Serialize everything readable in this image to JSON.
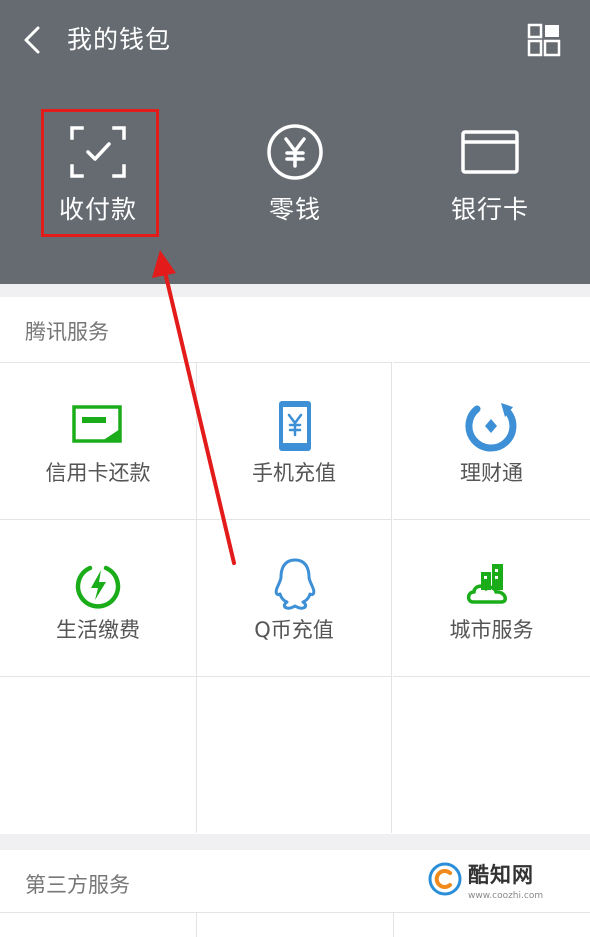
{
  "header": {
    "title": "我的钱包",
    "back_icon": "back-chevron-icon",
    "menu_icon": "grid-icon",
    "items": [
      {
        "label": "收付款",
        "icon": "scan-check-icon"
      },
      {
        "label": "零钱",
        "icon": "yuan-coin-icon"
      },
      {
        "label": "银行卡",
        "icon": "bank-card-icon"
      }
    ]
  },
  "tencent_services": {
    "title": "腾讯服务",
    "items": [
      {
        "label": "信用卡还款",
        "icon": "credit-card-repay-icon"
      },
      {
        "label": "手机充值",
        "icon": "phone-recharge-icon"
      },
      {
        "label": "理财通",
        "icon": "wealth-icon"
      },
      {
        "label": "生活缴费",
        "icon": "utility-bill-icon"
      },
      {
        "label": "Q币充值",
        "icon": "qq-penguin-icon"
      },
      {
        "label": "城市服务",
        "icon": "city-service-icon"
      }
    ]
  },
  "third_party_services": {
    "title": "第三方服务"
  },
  "watermark": {
    "name": "酷知网",
    "url": "www.coozhi.com"
  },
  "colors": {
    "header_bg": "#656b71",
    "highlight": "#e31b1b",
    "green": "#1aad19",
    "blue": "#3d8fd6"
  }
}
